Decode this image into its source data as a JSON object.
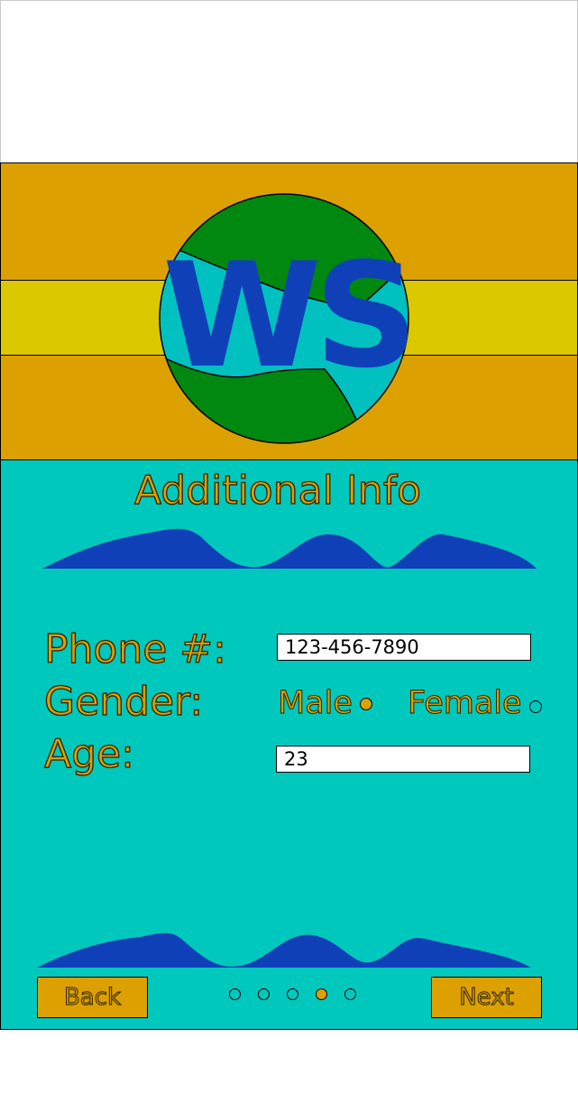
{
  "brand": {
    "logo_text": "WS"
  },
  "page": {
    "title": "Additional Info"
  },
  "form": {
    "phone": {
      "label": "Phone #:",
      "value": "123-456-7890"
    },
    "gender": {
      "label": "Gender:",
      "options": [
        {
          "label": "Male",
          "selected": true
        },
        {
          "label": "Female",
          "selected": false
        }
      ]
    },
    "age": {
      "label": "Age:",
      "value": "23"
    }
  },
  "navigation": {
    "back_label": "Back",
    "next_label": "Next",
    "steps_total": 5,
    "current_step": 4
  },
  "colors": {
    "gold": "#dca000",
    "yellow": "#dcc800",
    "teal": "#00c8bc",
    "blue": "#1040b8",
    "green": "#008810",
    "globe_water": "#00c0c0"
  }
}
